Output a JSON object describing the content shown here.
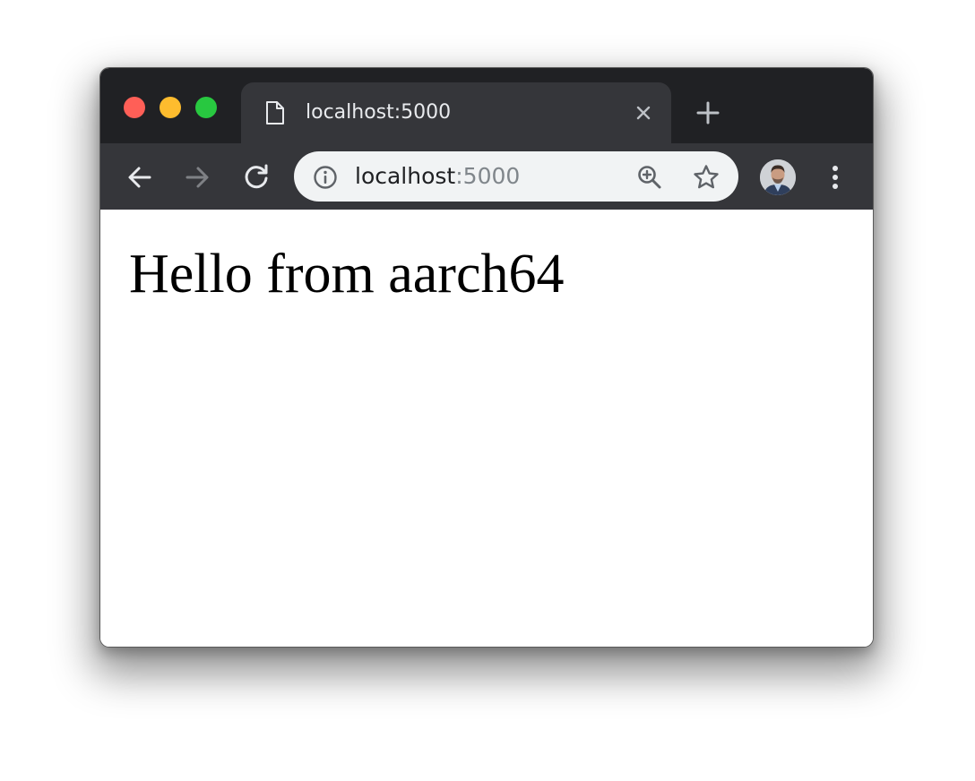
{
  "tab": {
    "title": "localhost:5000",
    "icon": "document-icon"
  },
  "address_bar": {
    "host": "localhost",
    "port": ":5000"
  },
  "toolbar": {
    "back_icon": "arrow-left-icon",
    "forward_icon": "arrow-right-icon",
    "reload_icon": "reload-icon",
    "zoom_icon": "zoom-in-icon",
    "bookmark_icon": "star-icon",
    "menu_icon": "more-vertical-icon"
  },
  "page": {
    "heading": "Hello from aarch64"
  },
  "colors": {
    "titlebar": "#202124",
    "tab_background": "#35363a",
    "omnibox": "#f1f3f4",
    "close": "#ff5f57",
    "minimize": "#febc2e",
    "maximize": "#28c840"
  }
}
